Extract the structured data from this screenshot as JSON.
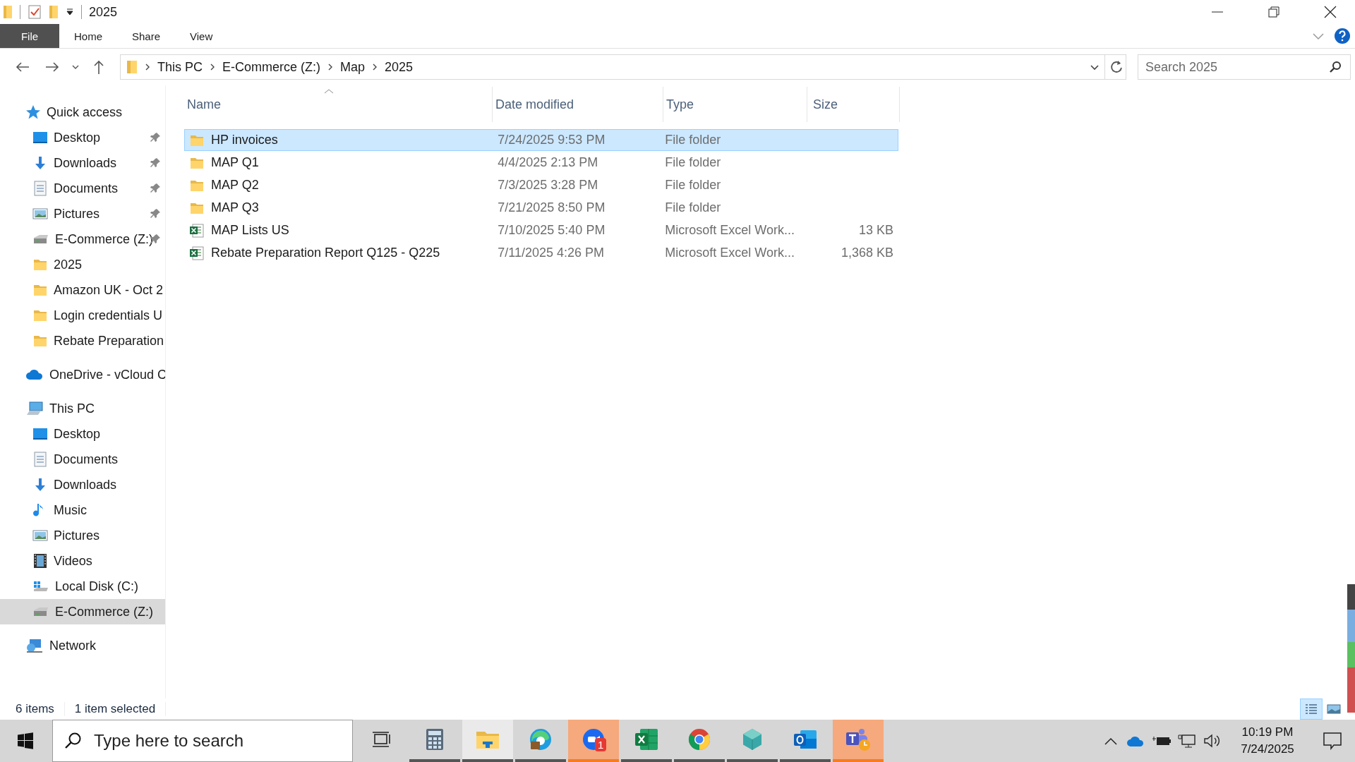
{
  "title_bar": {
    "title": "2025"
  },
  "ribbon_tabs": [
    {
      "label": "File",
      "kind": "file"
    },
    {
      "label": "Home",
      "kind": "tab"
    },
    {
      "label": "Share",
      "kind": "tab"
    },
    {
      "label": "View",
      "kind": "tab"
    }
  ],
  "address_bar": {
    "crumbs": [
      "This PC",
      "E-Commerce (Z:)",
      "Map",
      "2025"
    ]
  },
  "search": {
    "placeholder": "Search 2025"
  },
  "sidebar": {
    "sections": [
      {
        "label": "Quick access",
        "kind": "star",
        "selected": false,
        "children": [
          {
            "label": "Desktop",
            "kind": "desktop",
            "pinned": true,
            "selected": false
          },
          {
            "label": "Downloads",
            "kind": "download",
            "pinned": true,
            "selected": false
          },
          {
            "label": "Documents",
            "kind": "document",
            "pinned": true,
            "selected": false
          },
          {
            "label": "Pictures",
            "kind": "picture",
            "pinned": true,
            "selected": false
          },
          {
            "label": "E-Commerce (Z:)",
            "kind": "drive",
            "pinned": true,
            "selected": false
          },
          {
            "label": "2025",
            "kind": "folder",
            "pinned": false,
            "selected": false
          },
          {
            "label": "Amazon UK - Oct 2",
            "kind": "folder",
            "pinned": false,
            "selected": false
          },
          {
            "label": "Login credentials U",
            "kind": "folder",
            "pinned": false,
            "selected": false
          },
          {
            "label": "Rebate Preparation",
            "kind": "folder",
            "pinned": false,
            "selected": false
          }
        ]
      },
      {
        "label": "OneDrive - vCloud C",
        "kind": "cloud",
        "selected": false
      },
      {
        "label": "This PC",
        "kind": "pc",
        "selected": false,
        "children": [
          {
            "label": "Desktop",
            "kind": "desktop",
            "pinned": false,
            "selected": false
          },
          {
            "label": "Documents",
            "kind": "document",
            "pinned": false,
            "selected": false
          },
          {
            "label": "Downloads",
            "kind": "download",
            "pinned": false,
            "selected": false
          },
          {
            "label": "Music",
            "kind": "music",
            "pinned": false,
            "selected": false
          },
          {
            "label": "Pictures",
            "kind": "picture",
            "pinned": false,
            "selected": false
          },
          {
            "label": "Videos",
            "kind": "video",
            "pinned": false,
            "selected": false
          },
          {
            "label": "Local Disk (C:)",
            "kind": "disk",
            "pinned": false,
            "selected": false
          },
          {
            "label": "E-Commerce (Z:)",
            "kind": "drive",
            "pinned": false,
            "selected": true
          }
        ]
      },
      {
        "label": "Network",
        "kind": "network",
        "selected": false
      }
    ]
  },
  "table": {
    "columns": [
      {
        "label": "Name",
        "sorted": true
      },
      {
        "label": "Date modified",
        "sorted": false
      },
      {
        "label": "Type",
        "sorted": false
      },
      {
        "label": "Size",
        "sorted": false
      }
    ],
    "rows": [
      {
        "name": "HP invoices",
        "date": "7/24/2025 9:53 PM",
        "type": "File folder",
        "kind": "folder",
        "selected": true
      },
      {
        "name": "MAP Q1",
        "date": "4/4/2025 2:13 PM",
        "type": "File folder",
        "kind": "folder",
        "selected": false
      },
      {
        "name": "MAP Q2",
        "date": "7/3/2025 3:28 PM",
        "type": "File folder",
        "kind": "folder",
        "selected": false
      },
      {
        "name": "MAP Q3",
        "date": "7/21/2025 8:50 PM",
        "type": "File folder",
        "kind": "folder",
        "selected": false
      },
      {
        "name": "MAP Lists US",
        "date": "7/10/2025 5:40 PM",
        "type": "Microsoft Excel Work...",
        "size": "13 KB",
        "kind": "excel",
        "selected": false
      },
      {
        "name": "Rebate Preparation Report Q125 - Q225",
        "date": "7/11/2025 4:26 PM",
        "type": "Microsoft Excel Work...",
        "size": "1,368 KB",
        "kind": "excel",
        "selected": false
      }
    ]
  },
  "status_bar": {
    "item_count": "6 items",
    "selection": "1 item selected"
  },
  "views": [
    {
      "kind": "details",
      "selected": true
    },
    {
      "kind": "large",
      "selected": false
    }
  ],
  "taskbar": {
    "search_placeholder": "Type here to search",
    "apps": [
      {
        "kind": "taskview",
        "running": false,
        "active": false,
        "flashing": false
      },
      {
        "kind": "calculator",
        "running": true,
        "active": false,
        "flashing": false
      },
      {
        "kind": "explorer",
        "running": true,
        "active": true,
        "flashing": false
      },
      {
        "kind": "edge",
        "running": true,
        "active": false,
        "flashing": false
      },
      {
        "kind": "zoom",
        "running": true,
        "active": false,
        "flashing": true,
        "badge": "1"
      },
      {
        "kind": "excel",
        "running": true,
        "active": false,
        "flashing": false
      },
      {
        "kind": "chrome",
        "running": true,
        "active": false,
        "flashing": false
      },
      {
        "kind": "hexapp",
        "running": true,
        "active": false,
        "flashing": false
      },
      {
        "kind": "outlook",
        "running": true,
        "active": false,
        "flashing": false
      },
      {
        "kind": "teams",
        "running": true,
        "active": false,
        "flashing": true
      }
    ],
    "time": "10:19 PM",
    "date": "7/24/2025"
  }
}
